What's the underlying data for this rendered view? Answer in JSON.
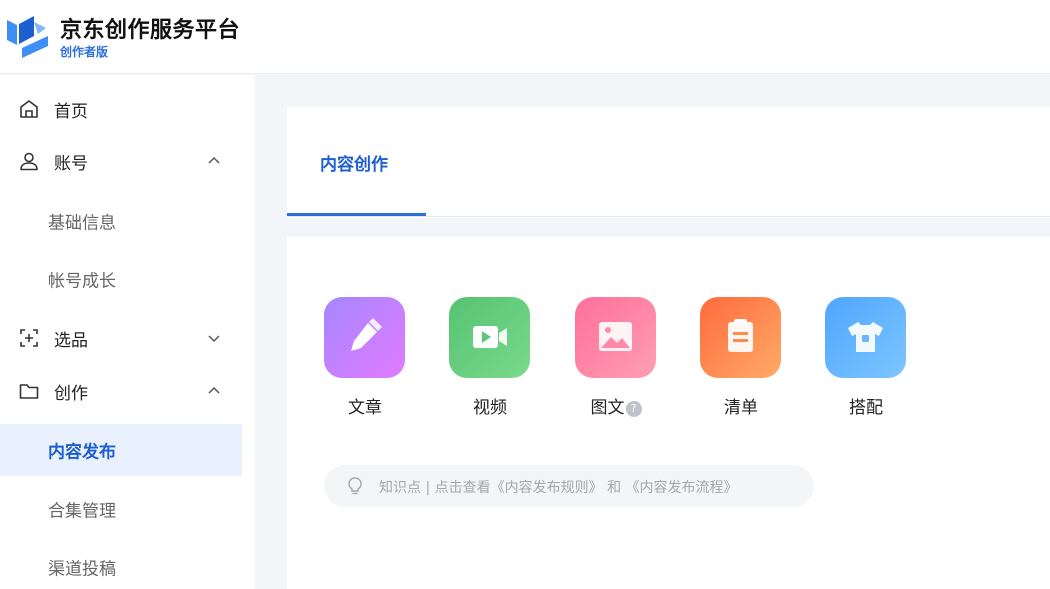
{
  "brand": {
    "title": "京东创作服务平台",
    "subtitle": "创作者版",
    "accent": "#2f6fe0"
  },
  "sidebar": {
    "items": [
      {
        "label": "首页",
        "icon": "home-icon"
      },
      {
        "label": "账号",
        "icon": "user-icon",
        "chevron": "chevron-up-icon",
        "expanded": true
      },
      {
        "label": "基础信息"
      },
      {
        "label": "帐号成长"
      },
      {
        "label": "选品",
        "icon": "select-product-icon",
        "chevron": "chevron-down-icon",
        "expanded": false
      },
      {
        "label": "创作",
        "icon": "folder-icon",
        "chevron": "chevron-up-icon",
        "expanded": true
      },
      {
        "label": "内容发布",
        "active": true
      },
      {
        "label": "合集管理"
      },
      {
        "label": "渠道投稿"
      }
    ],
    "active_bg": "#e8f1fd",
    "active_color": "#1d5fcf"
  },
  "tabs": [
    {
      "label": "内容创作",
      "active": true
    }
  ],
  "tools": [
    {
      "label": "文章",
      "icon": "pencil-icon",
      "colors": [
        "#a787ff",
        "#e07bff"
      ]
    },
    {
      "label": "视频",
      "icon": "video-camera-icon",
      "colors": [
        "#55c372",
        "#7bd98c"
      ]
    },
    {
      "label": "图文",
      "icon": "image-icon",
      "colors": [
        "#ff6f9a",
        "#ff9eb3"
      ],
      "help": "?"
    },
    {
      "label": "清单",
      "icon": "list-document-icon",
      "colors": [
        "#ff6a3d",
        "#ffab66"
      ]
    },
    {
      "label": "搭配",
      "icon": "tshirt-icon",
      "colors": [
        "#4fa6ff",
        "#7cc6ff"
      ]
    }
  ],
  "tip": {
    "icon": "lightbulb-icon",
    "prefix": "知识点 | 点击查看",
    "link1": "《内容发布规则》",
    "middle": " 和 ",
    "link2": "《内容发布流程》"
  }
}
